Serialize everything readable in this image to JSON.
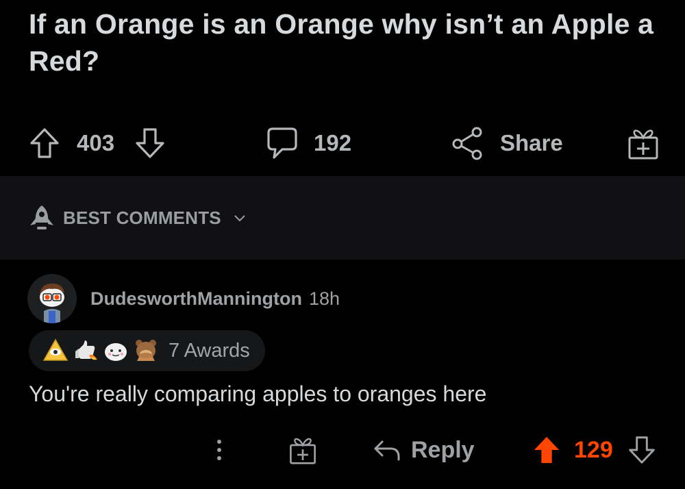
{
  "post": {
    "title": "If an Orange is an Orange why isn’t an Apple a Red?",
    "score": "403",
    "comments_count": "192",
    "share_label": "Share"
  },
  "sort": {
    "label": "BEST COMMENTS"
  },
  "comment": {
    "username": "DudesworthMannington",
    "timestamp": "18h",
    "awards_label": "7 Awards",
    "awards": [
      "illuminati-award-icon",
      "thumbs-up-rocket-award-icon",
      "wholesome-ghost-award-icon",
      "facepalm-bear-award-icon"
    ],
    "body": "You're really comparing apples to oranges here",
    "reply_label": "Reply",
    "score": "129"
  },
  "colors": {
    "background": "#000000",
    "sort_bar": "#111113",
    "text": "#d7dadc",
    "muted": "#9ea2a5",
    "upvote_active": "#ff4500"
  }
}
